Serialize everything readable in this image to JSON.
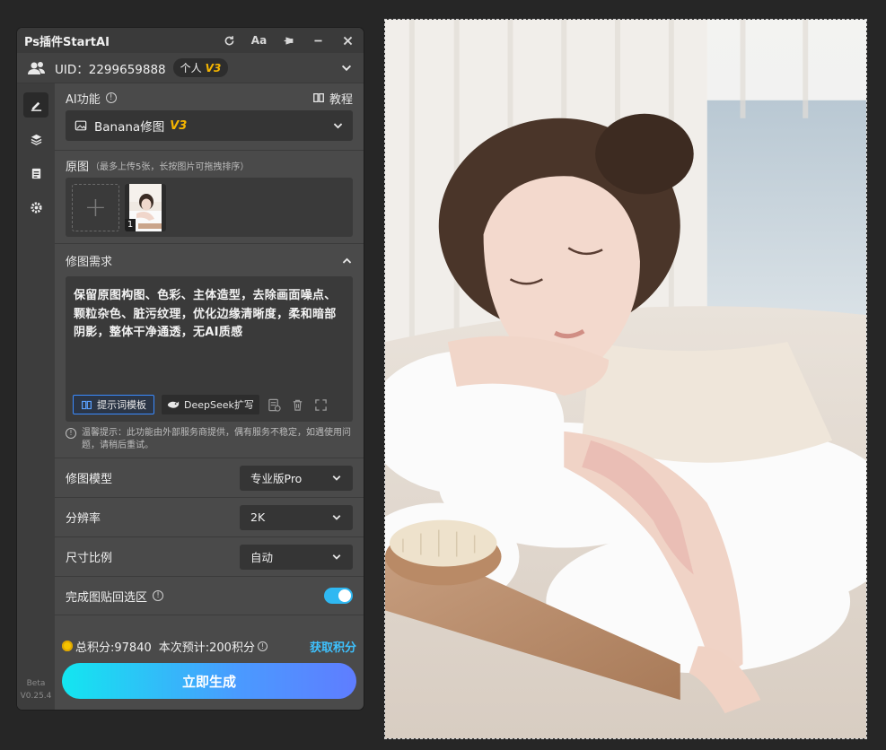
{
  "window": {
    "title": "Ps插件StartAI"
  },
  "titlebar_icons": [
    "refresh-icon",
    "font-size-icon",
    "pin-icon",
    "minimize-icon",
    "close-icon"
  ],
  "titlebar": {
    "font_label": "Aa"
  },
  "user": {
    "uid_label": "UID：2299659888",
    "plan": "个人",
    "version_badge": "V3"
  },
  "rail": {
    "items": [
      "edit-icon",
      "layers-icon",
      "notes-icon",
      "settings-icon"
    ],
    "beta": "Beta",
    "version": "V0.25.4"
  },
  "ai": {
    "label": "AI功能",
    "info": "!",
    "tutorial": "教程",
    "function": "Banana修图",
    "function_badge": "V3"
  },
  "source": {
    "label": "原图",
    "hint": "（最多上传5张，长按图片可拖拽排序）",
    "add": "+",
    "thumb_index": "1"
  },
  "requirement": {
    "label": "修图需求",
    "text": "保留原图构图、色彩、主体造型，去除画面噪点、颗粒杂色、脏污纹理，优化边缘清晰度，柔和暗部阴影，整体干净通透，无AI质感",
    "template_button": "提示词模板",
    "deepseek_button": "DeepSeek扩写"
  },
  "notice": {
    "icon": "!",
    "text": "温馨提示：此功能由外部服务商提供，偶有服务不稳定，如遇使用问题，请稍后重试。"
  },
  "options": {
    "model": {
      "label": "修图模型",
      "value": "专业版Pro"
    },
    "resolution": {
      "label": "分辨率",
      "value": "2K"
    },
    "ratio": {
      "label": "尺寸比例",
      "value": "自动"
    },
    "paste": {
      "label": "完成图贴回选区",
      "info": "!",
      "enabled": true
    }
  },
  "points": {
    "total": "总积分:97840",
    "estimate": "本次预计:200积分",
    "info": "!",
    "earn": "获取积分"
  },
  "generate_button": "立即生成",
  "colors": {
    "accent": "#3b8bff",
    "badge": "#f5b500",
    "toggle": "#2fb8f2",
    "link": "#3ec2ff"
  }
}
